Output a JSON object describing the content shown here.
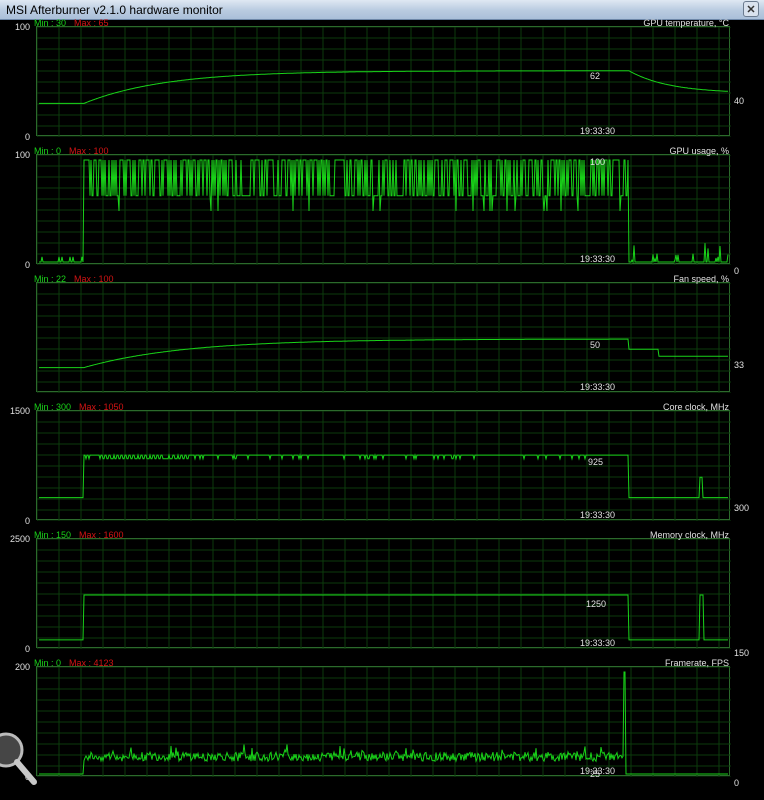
{
  "window": {
    "title": "MSI Afterburner v2.1.0 hardware monitor"
  },
  "icons": {
    "close": "close-icon",
    "zoom": "magnifier-icon"
  },
  "colors": {
    "graph": "#19d319",
    "grid": "#0c3a0c",
    "min": "#19d319",
    "max": "#d41414",
    "text": "#e0e0e0"
  },
  "panels": [
    {
      "title": "GPU temperature, °C",
      "min_label": "Min : 30",
      "max_label": "Max : 65",
      "y_max": "100",
      "y_min": "0",
      "peak_label": "62",
      "current_label": "40",
      "time_label": "19:33:30",
      "scale_max": 100,
      "pattern": "temp",
      "current": 40,
      "peak": 62
    },
    {
      "title": "GPU usage, %",
      "min_label": "Min : 0",
      "max_label": "Max : 100",
      "y_max": "100",
      "y_min": "0",
      "peak_label": "100",
      "current_label": "0",
      "time_label": "19:33:30",
      "scale_max": 100,
      "pattern": "usage",
      "current": 0,
      "peak": 100
    },
    {
      "title": "Fan speed, %",
      "min_label": "Min : 22",
      "max_label": "Max : 100",
      "y_max": "",
      "y_min": "",
      "peak_label": "50",
      "current_label": "33",
      "time_label": "19:33:30",
      "scale_max": 100,
      "pattern": "fan",
      "current": 33,
      "peak": 50
    },
    {
      "title": "Core clock, MHz",
      "min_label": "Min : 300",
      "max_label": "Max : 1050",
      "y_max": "1500",
      "y_min": "0",
      "peak_label": "925",
      "current_label": "300",
      "time_label": "19:33:30",
      "scale_max": 1500,
      "pattern": "core",
      "current": 300,
      "peak": 925
    },
    {
      "title": "Memory clock, MHz",
      "min_label": "Min : 150",
      "max_label": "Max : 1600",
      "y_max": "2500",
      "y_min": "0",
      "peak_label": "1250",
      "current_label": "150",
      "time_label": "19:33:30",
      "scale_max": 2500,
      "pattern": "mem",
      "current": 150,
      "peak": 1250
    },
    {
      "title": "Framerate, FPS",
      "min_label": "Min : 0",
      "max_label": "Max : 4123",
      "y_max": "200",
      "y_min": "0",
      "peak_label": "25",
      "current_label": "0",
      "time_label": "19:33:30",
      "scale_max": 200,
      "pattern": "fps",
      "current": 0,
      "peak": 25
    }
  ]
}
